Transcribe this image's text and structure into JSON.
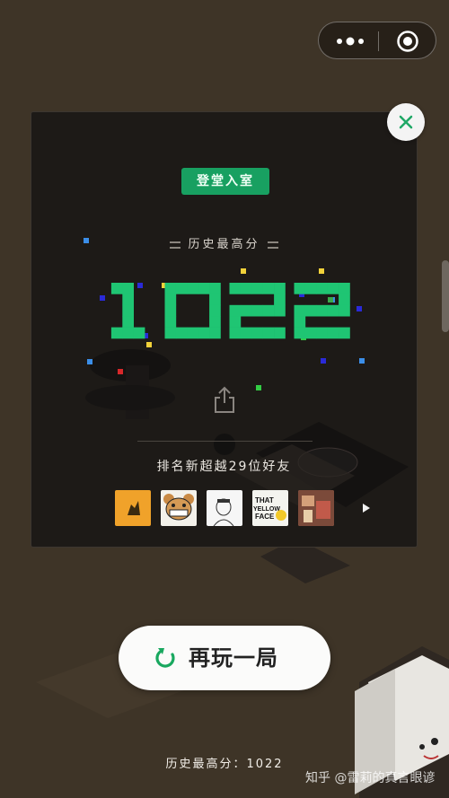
{
  "header": {
    "more_icon": "more-dots-icon",
    "target_icon": "record-target-icon"
  },
  "panel": {
    "badge": "登堂入室",
    "high_score_label": "历史最高分",
    "score": "1022",
    "share_icon": "share-icon",
    "rank_text": "排名新超越29位好友",
    "friends": [
      {
        "name": "friend-avatar-1",
        "color": "#f0a22a"
      },
      {
        "name": "friend-avatar-2",
        "color": "#f3f1ea"
      },
      {
        "name": "friend-avatar-3",
        "color": "#f6f6f6"
      },
      {
        "name": "friend-avatar-4",
        "color": "#f4f4ef",
        "text": "THAT YELLOW FACE"
      },
      {
        "name": "friend-avatar-5",
        "color": "#b9775a"
      }
    ],
    "close_icon": "close-icon",
    "more_friends_icon": "chevron-right-icon",
    "accent": "#1fc573"
  },
  "replay": {
    "label": "再玩一局",
    "icon": "refresh-icon"
  },
  "footer": {
    "high_score": "历史最高分：1022"
  },
  "watermark": "知乎 @雷莉的真言眼谚"
}
